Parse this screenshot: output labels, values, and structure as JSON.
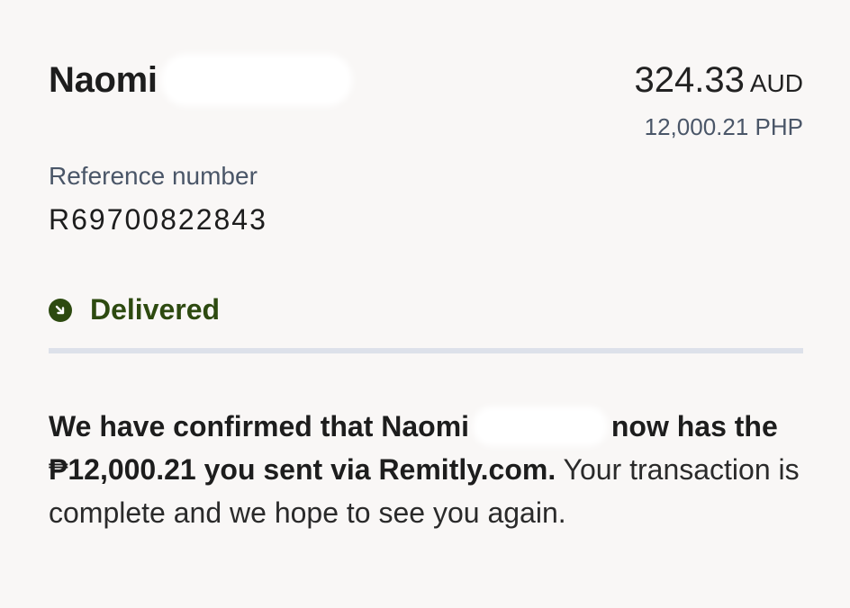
{
  "recipient": {
    "name": "Naomi"
  },
  "amount": {
    "sent_value": "324.33",
    "sent_currency": "AUD",
    "received": "12,000.21 PHP"
  },
  "reference": {
    "label": "Reference number",
    "value": "R69700822843"
  },
  "status": {
    "label": "Delivered",
    "icon": "arrow-down-right-circle-icon",
    "color": "#2d4a10"
  },
  "message": {
    "part1": "We have confirmed that Naomi",
    "part2": "now has the ₱12,000.21 you sent via Remitly.com.",
    "part3": " Your transaction is complete and we hope to see you again."
  }
}
